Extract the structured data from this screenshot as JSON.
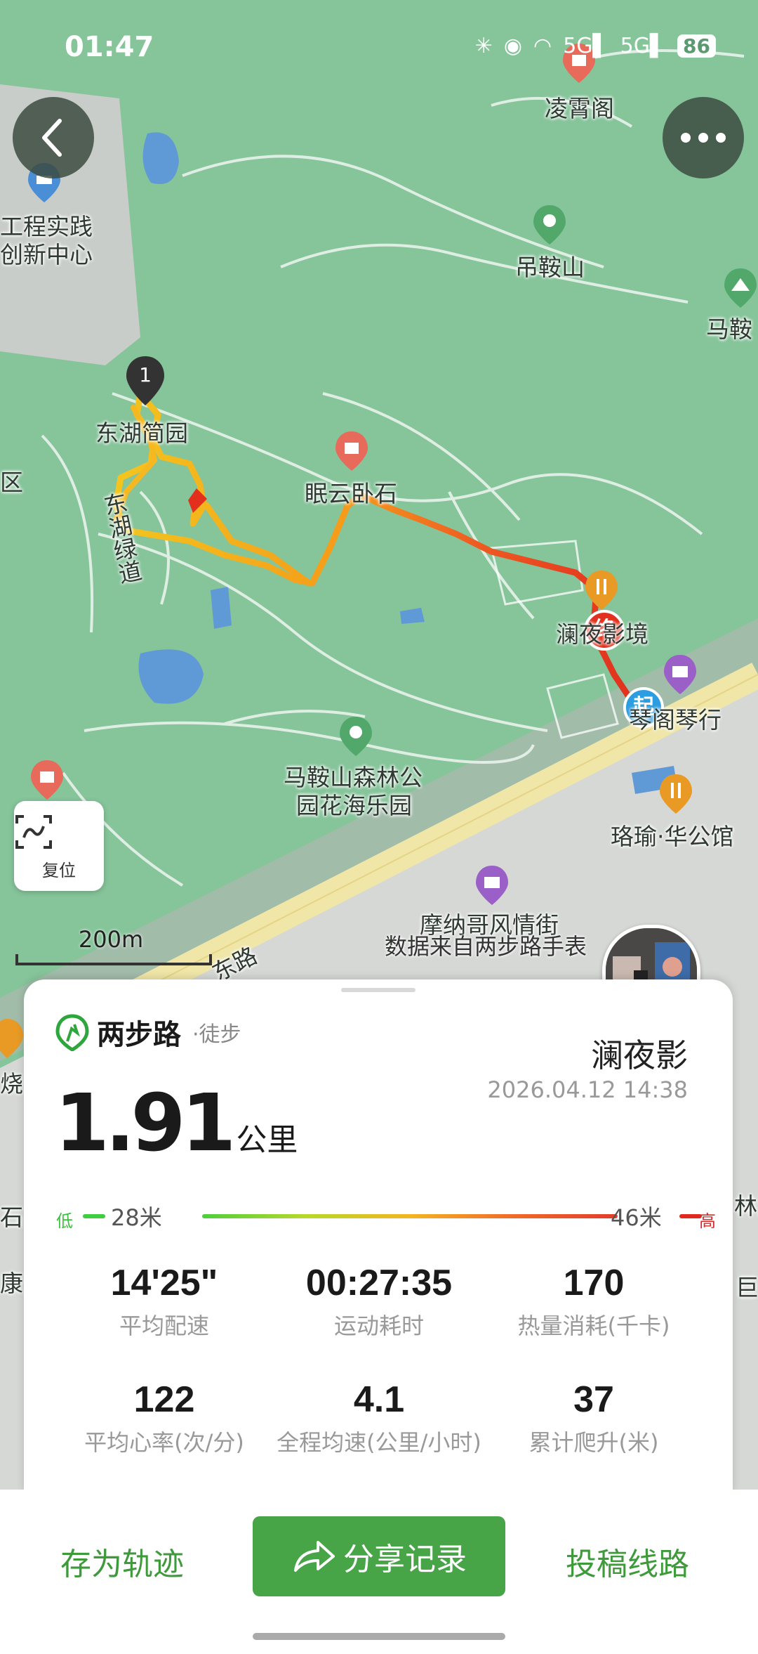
{
  "status_bar": {
    "time": "01:47",
    "battery": "86",
    "signal1": "5G",
    "signal2": "5G"
  },
  "map": {
    "labels": {
      "lingxiao": "凌霄阁",
      "engineering_1": "工程实践",
      "engineering_2": "创新中心",
      "diaoan": "吊鞍山",
      "maan_edge": "马鞍",
      "donghu": "东湖简园",
      "mianyun": "眠云卧石",
      "greenway": "东湖绿道",
      "lanye": "澜夜影境",
      "qinhang": "琴阁琴行",
      "forest_1": "马鞍山森林公",
      "forest_2": "园花海乐园",
      "luoyu": "珞瑜·华公馆",
      "monaco": "摩纳哥风情街",
      "road": "东路",
      "district": "区",
      "left_bottom": "烧",
      "right_bottom": "林湖",
      "misc_left_1": "石",
      "misc_left_2": "康",
      "misc_right": "巨"
    },
    "waypoint": "1",
    "start_marker": "起",
    "end_marker": "终",
    "reset_label": "复位",
    "scale_label": "200m",
    "watermark": "数据来自两步路手表"
  },
  "card": {
    "brand": "两步路",
    "activity_type": "·徒步",
    "user_name": "澜夜影",
    "datetime": "2026.04.12 14:38",
    "distance_value": "1.91",
    "distance_unit": "公里",
    "elevation": {
      "low_label": "低",
      "high_label": "高",
      "min": "28米",
      "max": "46米"
    },
    "stats": [
      {
        "value": "14'25\"",
        "label": "平均配速"
      },
      {
        "value": "00:27:35",
        "label": "运动耗时"
      },
      {
        "value": "170",
        "label": "热量消耗(千卡)"
      },
      {
        "value": "122",
        "label": "平均心率(次/分)"
      },
      {
        "value": "4.1",
        "label": "全程均速(公里/小时)"
      },
      {
        "value": "37",
        "label": "累计爬升(米)"
      }
    ]
  },
  "actions": {
    "save_track": "存为轨迹",
    "share": "分享记录",
    "submit_route": "投稿线路"
  },
  "colors": {
    "accent": "#47a447",
    "map_green": "#86c49a",
    "track_start": "#f2c21b",
    "track_end": "#e0301e"
  }
}
